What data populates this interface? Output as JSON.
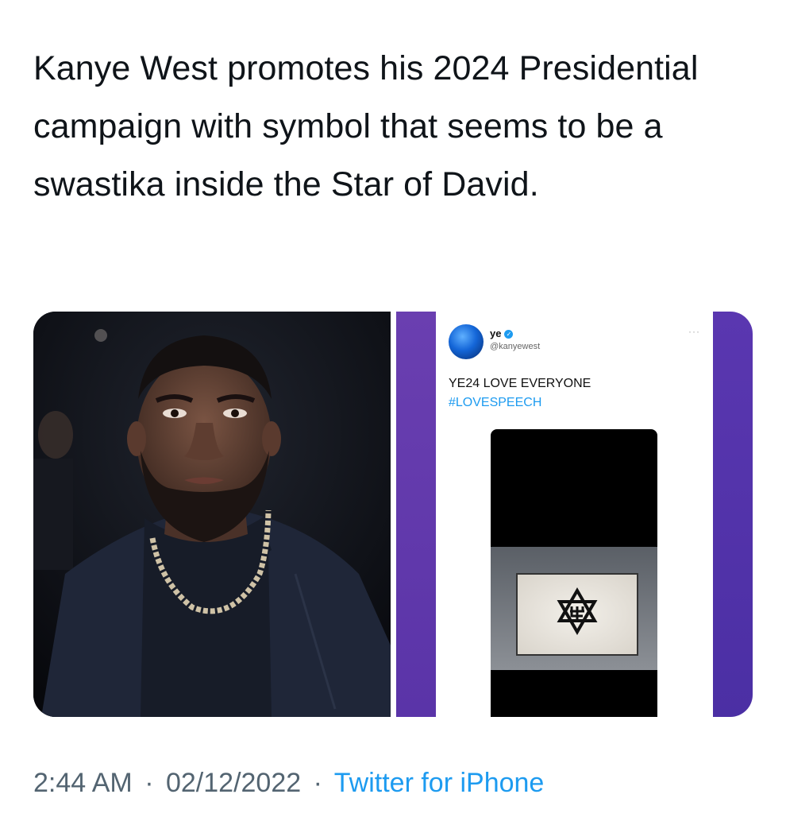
{
  "tweet": {
    "text": "Kanye West promotes his 2024 Presidential campaign with symbol that seems to be a swastika inside the Star of David."
  },
  "embedded_tweet": {
    "name": "ye",
    "handle": "@kanyewest",
    "line1": "YE24 LOVE EVERYONE",
    "line2": "#LOVESPEECH",
    "more": "···"
  },
  "footer": {
    "time": "2:44 AM",
    "separator": "·",
    "date": "02/12/2022",
    "source": "Twitter for iPhone"
  },
  "colors": {
    "text": "#0f1419",
    "secondary": "#536471",
    "link": "#1d9bf0",
    "purple": "#5a34a8"
  },
  "icons": [
    "verified-badge-icon",
    "star-of-david-symbol-icon",
    "more-options-icon"
  ]
}
